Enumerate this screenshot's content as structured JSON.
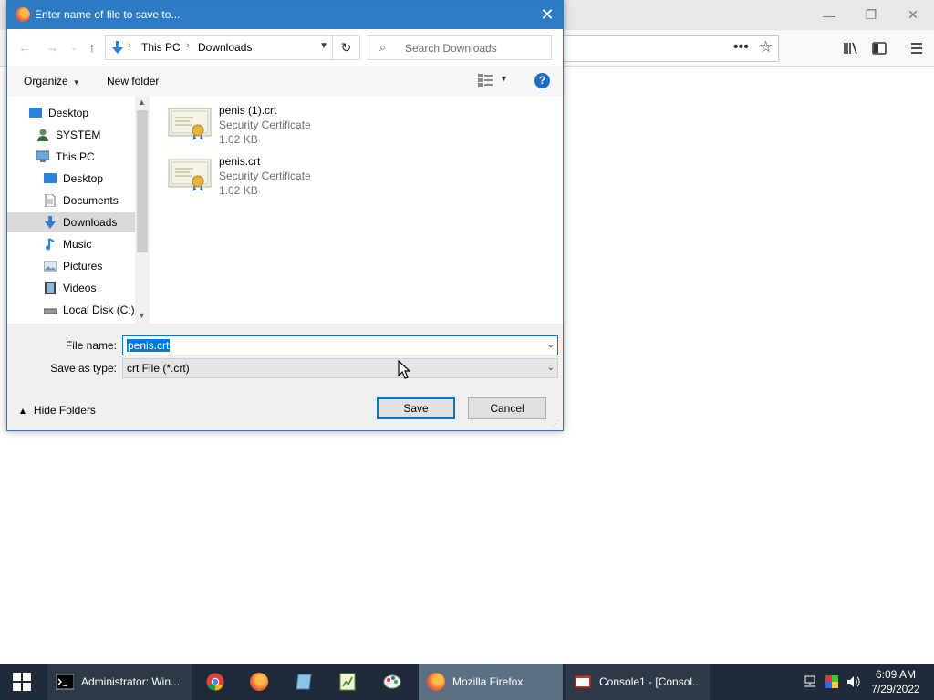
{
  "dialog": {
    "title": "Enter name of file to save to...",
    "breadcrumb": [
      "This PC",
      "Downloads"
    ],
    "search_placeholder": "Search Downloads",
    "commands": {
      "organize": "Organize",
      "new_folder": "New folder"
    },
    "nav_items": [
      {
        "label": "Desktop",
        "icon": "desktop-icon"
      },
      {
        "label": "SYSTEM",
        "icon": "user-icon"
      },
      {
        "label": "This PC",
        "icon": "computer-icon"
      },
      {
        "label": "Desktop",
        "icon": "desktop-icon"
      },
      {
        "label": "Documents",
        "icon": "documents-icon"
      },
      {
        "label": "Downloads",
        "icon": "downloads-icon",
        "selected": true
      },
      {
        "label": "Music",
        "icon": "music-icon"
      },
      {
        "label": "Pictures",
        "icon": "pictures-icon"
      },
      {
        "label": "Videos",
        "icon": "videos-icon"
      },
      {
        "label": "Local Disk (C:)",
        "icon": "disk-icon"
      }
    ],
    "files": [
      {
        "name": "penis (1).crt",
        "type": "Security Certificate",
        "size": "1.02 KB"
      },
      {
        "name": "penis.crt",
        "type": "Security Certificate",
        "size": "1.02 KB"
      }
    ],
    "file_name_label": "File name:",
    "file_name_value": "penis.crt",
    "save_type_label": "Save as type:",
    "save_type_value": "crt File (*.crt)",
    "hide_folders": "Hide Folders",
    "save_button": "Save",
    "cancel_button": "Cancel",
    "help": "?"
  },
  "taskbar": {
    "items": [
      {
        "label": "Administrator: Win...",
        "icon": "cmd-icon"
      },
      {
        "label": "Mozilla Firefox",
        "icon": "firefox-icon",
        "active": true
      },
      {
        "label": "Console1 - [Consol...",
        "icon": "mmc-icon"
      }
    ],
    "time": "6:09 AM",
    "date": "7/29/2022"
  },
  "colors": {
    "title_bar": "#2d7bc4",
    "taskbar": "#1f2b38",
    "selection": "#0078d7"
  }
}
